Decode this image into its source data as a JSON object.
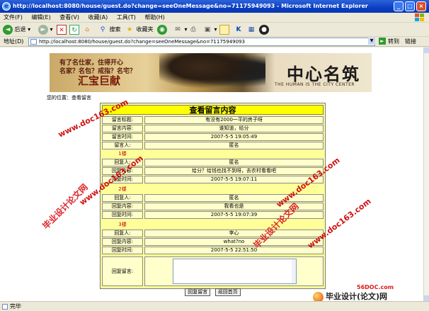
{
  "window": {
    "title": "http://localhost:8080/house/guest.do?change=seeOneMessage&no=71175949093 - Microsoft Internet Explorer",
    "min": "_",
    "max": "□",
    "close": "×"
  },
  "menu": [
    "文件(F)",
    "编辑(E)",
    "查看(V)",
    "收藏(A)",
    "工具(T)",
    "帮助(H)"
  ],
  "toolbar": {
    "back": "后退",
    "search": "搜索",
    "favorites": "收藏夹"
  },
  "address": {
    "label": "地址(D)",
    "url": "http://localhost:8080/house/guest.do?change=seeOneMessage&no=71175949093",
    "go": "转到",
    "links": "链接"
  },
  "banner": {
    "slogan_line1": "有了名仕家，住得开心",
    "slogan_line2": "名家？名包？戒指？名宅？",
    "brand_left": "汇宝巨献",
    "brand_right": "中心名筑",
    "tagline": "THE HUMAN IS THE CITY CENTER"
  },
  "location": "您的位置：查看留言",
  "message": {
    "heading": "查看留言内容",
    "rows": [
      {
        "label": "留言标题:",
        "value": "有没有2000一平的房子呀"
      },
      {
        "label": "留言内容:",
        "value": "谁知道，给分"
      },
      {
        "label": "留言时间:",
        "value": "2007-5-5 19:05:49"
      },
      {
        "label": "留言人:",
        "value": "匿名"
      }
    ],
    "replies": [
      {
        "floor": "1楼",
        "person_label": "回复人:",
        "person": "匿名",
        "content_label": "回复内容:",
        "content": "给分？给钱也找不到呀，去农村看看吧",
        "time_label": "回复时间:",
        "time": "2007-5-5 19:07:11"
      },
      {
        "floor": "2楼",
        "person_label": "回复人:",
        "person": "匿名",
        "content_label": "回复内容:",
        "content": "我看也是",
        "time_label": "回复时间:",
        "time": "2007-5-5 19:07:39"
      },
      {
        "floor": "3楼",
        "person_label": "回复人:",
        "person": "李心",
        "content_label": "回复内容:",
        "content": "what?no",
        "time_label": "回复时间:",
        "time": "2007-5-5 22:51:50"
      }
    ],
    "reply_label": "回复留言:",
    "reply_value": "",
    "btn_reply": "回复留言",
    "btn_home": "返回首页"
  },
  "status": "完毕",
  "watermarks": {
    "site": "www.doc163.com",
    "name": "毕业设计论文网",
    "logo_site": "56DOC.com",
    "logo_text": "毕业设计(论文)网"
  }
}
